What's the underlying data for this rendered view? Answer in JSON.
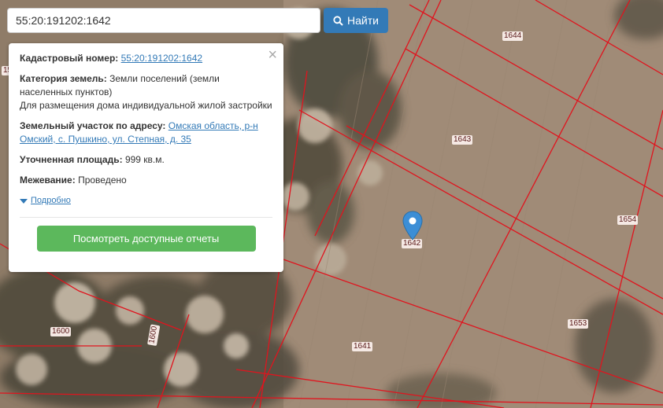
{
  "search": {
    "value": "55:20:191202:1642",
    "button_label": "Найти"
  },
  "popup": {
    "cadastral_label": "Кадастровый номер:",
    "cadastral_value": "55:20:191202:1642",
    "category_label": "Категория земель:",
    "category_value": "Земли поселений (земли населенных пунктов)",
    "category_purpose": "Для размещения дома индивидуальной жилой застройки",
    "address_label": "Земельный участок по адресу:",
    "address_value": "Омская область, р-н Омский, с. Пушкино, ул. Степная, д. 35",
    "area_label": "Уточненная площадь:",
    "area_value": "999 кв.м.",
    "survey_label": "Межевание:",
    "survey_value": "Проведено",
    "details_link": "Подробно",
    "reports_button": "Посмотреть доступные отчеты",
    "close_symbol": "×"
  },
  "map": {
    "parcel_labels": {
      "p1644": "1644",
      "p1643": "1643",
      "p1654": "1654",
      "p1642": "1642",
      "p1653": "1653",
      "p1641": "1641",
      "p1600a": "1600",
      "p1600b": "1600",
      "p15": "15"
    },
    "boundary_color": "#e0141e",
    "marker_color": "#3c8ed6"
  }
}
